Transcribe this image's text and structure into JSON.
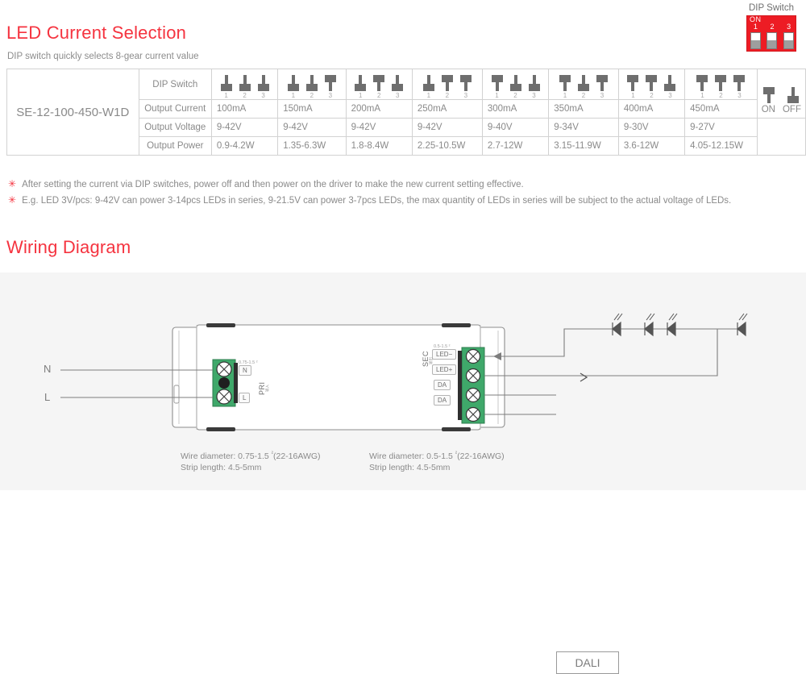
{
  "sections": {
    "led_current_title": "LED Current Selection",
    "led_current_subtitle": "DIP switch quickly selects 8-gear current value",
    "wiring_title": "Wiring Diagram"
  },
  "dip_badge": {
    "label": "DIP Switch",
    "on_text": "ON",
    "numbers": [
      "1",
      "2",
      "3"
    ],
    "body_color": "#ed1c24"
  },
  "table": {
    "model": "SE-12-100-450-W1D",
    "row_headers": [
      "DIP Switch",
      "Output Current",
      "Output Voltage",
      "Output Power"
    ],
    "dip_numbers": [
      "1",
      "2",
      "3"
    ],
    "columns": [
      {
        "dip": [
          "off",
          "off",
          "off"
        ],
        "current": "100mA",
        "voltage": "9-42V",
        "power": "0.9-4.2W"
      },
      {
        "dip": [
          "off",
          "off",
          "on"
        ],
        "current": "150mA",
        "voltage": "9-42V",
        "power": "1.35-6.3W"
      },
      {
        "dip": [
          "off",
          "on",
          "off"
        ],
        "current": "200mA",
        "voltage": "9-42V",
        "power": "1.8-8.4W"
      },
      {
        "dip": [
          "off",
          "on",
          "on"
        ],
        "current": "250mA",
        "voltage": "9-42V",
        "power": "2.25-10.5W"
      },
      {
        "dip": [
          "on",
          "off",
          "off"
        ],
        "current": "300mA",
        "voltage": "9-40V",
        "power": "2.7-12W"
      },
      {
        "dip": [
          "on",
          "off",
          "on"
        ],
        "current": "350mA",
        "voltage": "9-34V",
        "power": "3.15-11.9W"
      },
      {
        "dip": [
          "on",
          "on",
          "off"
        ],
        "current": "400mA",
        "voltage": "9-30V",
        "power": "3.6-12W"
      },
      {
        "dip": [
          "on",
          "on",
          "on"
        ],
        "current": "450mA",
        "voltage": "9-27V",
        "power": "4.05-12.15W"
      }
    ],
    "legend": {
      "on": "ON",
      "off": "OFF"
    }
  },
  "notes": [
    "After setting the current via DIP switches, power off and then power on the driver to make the new current setting effective.",
    "E.g. LED 3V/pcs: 9-42V can power 3-14pcs LEDs in series, 9-21.5V can power 3-7pcs LEDs, the max quantity of LEDs in series will be subject to the actual voltage of LEDs."
  ],
  "wiring": {
    "input_labels": {
      "n": "N",
      "l": "L"
    },
    "primary_side": {
      "name": "PRI",
      "sub": "输入",
      "wire_spec": "0.75-1.5 ²",
      "terminals": [
        "N",
        "L"
      ]
    },
    "secondary_side": {
      "name": "SEC",
      "sub": "输出",
      "wire_spec": "0.5-1.5 ²",
      "terminals": [
        "LED−",
        "LED+",
        "DA",
        "DA"
      ]
    },
    "dali_label": "DALI",
    "captions": {
      "primary_line1": "Wire diameter: 0.75-1.5 ",
      "primary_sup": "²",
      "primary_line1b": "(22-16AWG)",
      "primary_line2": "Strip length: 4.5-5mm",
      "secondary_line1": "Wire diameter: 0.5-1.5 ",
      "secondary_sup": "²",
      "secondary_line1b": "(22-16AWG)",
      "secondary_line2": "Strip length: 4.5-5mm"
    }
  },
  "colors": {
    "accent_red": "#f5333f",
    "dip_red": "#ed1c24",
    "terminal_green": "#3fa86a",
    "text_gray": "#8a8a8a",
    "panel_bg": "#f5f5f5"
  }
}
